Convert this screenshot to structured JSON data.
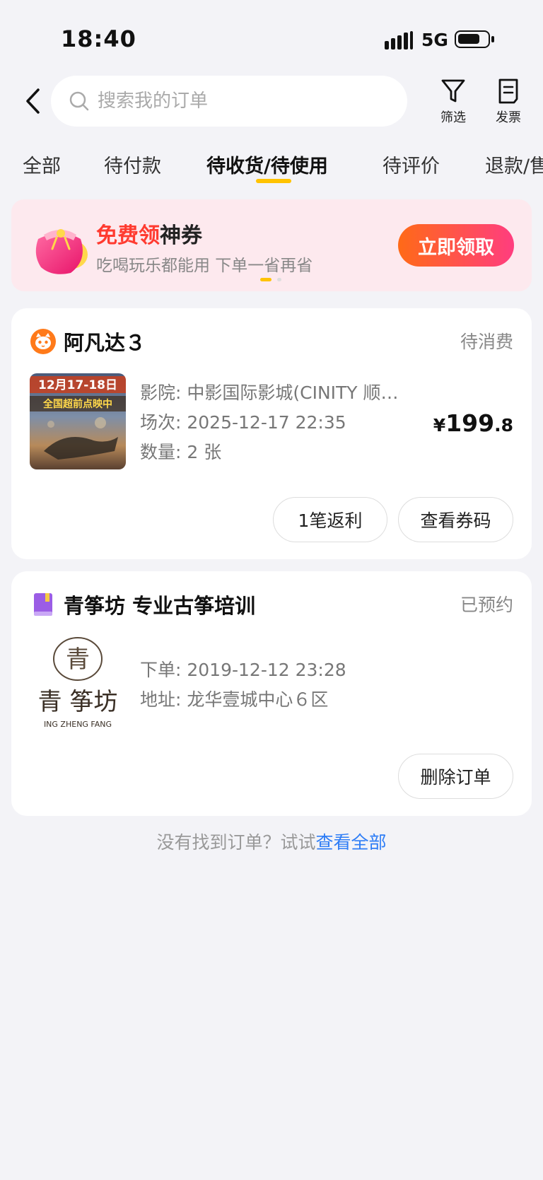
{
  "status_bar": {
    "time": "18:40",
    "network": "5G"
  },
  "header": {
    "search_placeholder": "搜索我的订单",
    "filter_label": "筛选",
    "invoice_label": "发票"
  },
  "tabs": [
    {
      "label": "全部"
    },
    {
      "label": "待付款"
    },
    {
      "label": "待收货/待使用",
      "active": true
    },
    {
      "label": "待评价"
    },
    {
      "label": "退款/售后"
    }
  ],
  "promo": {
    "title_highlight": "免费领",
    "title_rest": "神券",
    "subtitle": "吃喝玩乐都能用 下单一省再省",
    "button": "立即领取"
  },
  "orders": [
    {
      "shop": "阿凡达３",
      "status": "待消费",
      "lines": [
        "影院: 中影国际影城(CINITY 顺…",
        "场次: 2025-12-17 22:35",
        "数量: 2 张"
      ],
      "price": {
        "currency": "¥",
        "integer": "199",
        "decimal": ".8"
      },
      "buttons": [
        "1笔返利",
        "查看券码"
      ],
      "thumb_text": [
        "12月17-18日",
        "全国超前点映中"
      ]
    },
    {
      "shop": "青筝坊 专业古筝培训",
      "status": "已预约",
      "lines": [
        "下单: 2019-12-12 23:28",
        "地址: 龙华壹城中心６区"
      ],
      "buttons": [
        "删除订单"
      ],
      "thumb_text": [
        "青",
        "青筝坊",
        "ING ZHENG FANG"
      ]
    }
  ],
  "footer_hint": {
    "text": "没有找到订单？试试",
    "link": "查看全部"
  },
  "colors": {
    "accent_yellow": "#ffc300",
    "link_blue": "#2e7df6",
    "promo_red": "#ff3b30"
  }
}
